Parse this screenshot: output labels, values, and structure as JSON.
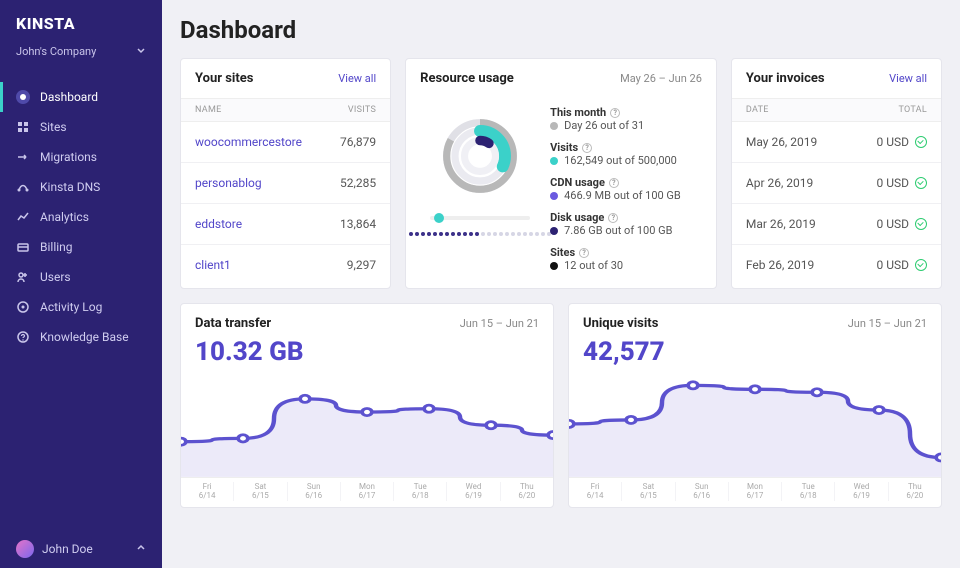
{
  "brand": "KINSTA",
  "company": "John's Company",
  "page_title": "Dashboard",
  "nav": [
    {
      "label": "Dashboard",
      "icon": "home"
    },
    {
      "label": "Sites",
      "icon": "sites"
    },
    {
      "label": "Migrations",
      "icon": "migrate"
    },
    {
      "label": "Kinsta DNS",
      "icon": "dns"
    },
    {
      "label": "Analytics",
      "icon": "analytics"
    },
    {
      "label": "Billing",
      "icon": "billing"
    },
    {
      "label": "Users",
      "icon": "users"
    },
    {
      "label": "Activity Log",
      "icon": "log"
    },
    {
      "label": "Knowledge Base",
      "icon": "kb"
    }
  ],
  "user": {
    "name": "John Doe"
  },
  "sites_card": {
    "title": "Your sites",
    "view_all": "View all",
    "head_name": "NAME",
    "head_visits": "VISITS",
    "rows": [
      {
        "name": "woocommercestore",
        "visits": "76,879"
      },
      {
        "name": "personablog",
        "visits": "52,285"
      },
      {
        "name": "eddstore",
        "visits": "13,864"
      },
      {
        "name": "client1",
        "visits": "9,297"
      }
    ]
  },
  "resource_card": {
    "title": "Resource usage",
    "range": "May 26 – Jun 26",
    "stats": [
      {
        "label": "This month",
        "value": "Day 26 out of 31",
        "color": "#b8b8b8"
      },
      {
        "label": "Visits",
        "value": "162,549 out of 500,000",
        "color": "#3bd1c9"
      },
      {
        "label": "CDN usage",
        "value": "466.9 MB out of 100 GB",
        "color": "#6a5ae0"
      },
      {
        "label": "Disk usage",
        "value": "7.86 GB out of 100 GB",
        "color": "#2c2272"
      },
      {
        "label": "Sites",
        "value": "12 out of 30",
        "color": "#111"
      }
    ]
  },
  "invoices_card": {
    "title": "Your invoices",
    "view_all": "View all",
    "head_date": "DATE",
    "head_total": "TOTAL",
    "rows": [
      {
        "date": "May 26, 2019",
        "amount": "0 USD"
      },
      {
        "date": "Apr 26, 2019",
        "amount": "0 USD"
      },
      {
        "date": "Mar 26, 2019",
        "amount": "0 USD"
      },
      {
        "date": "Feb 26, 2019",
        "amount": "0 USD"
      }
    ]
  },
  "data_transfer_card": {
    "title": "Data transfer",
    "range": "Jun 15 – Jun 21",
    "big_value": "10.32 GB",
    "axis": [
      {
        "dow": "Fri",
        "date": "6/14"
      },
      {
        "dow": "Sat",
        "date": "6/15"
      },
      {
        "dow": "Sun",
        "date": "6/16"
      },
      {
        "dow": "Mon",
        "date": "6/17"
      },
      {
        "dow": "Tue",
        "date": "6/18"
      },
      {
        "dow": "Wed",
        "date": "6/19"
      },
      {
        "dow": "Thu",
        "date": "6/20"
      }
    ]
  },
  "unique_visits_card": {
    "title": "Unique visits",
    "range": "Jun 15 – Jun 21",
    "big_value": "42,577",
    "axis": [
      {
        "dow": "Fri",
        "date": "6/14"
      },
      {
        "dow": "Sat",
        "date": "6/15"
      },
      {
        "dow": "Sun",
        "date": "6/16"
      },
      {
        "dow": "Mon",
        "date": "6/17"
      },
      {
        "dow": "Tue",
        "date": "6/18"
      },
      {
        "dow": "Wed",
        "date": "6/19"
      },
      {
        "dow": "Thu",
        "date": "6/20"
      }
    ]
  },
  "chart_data": [
    {
      "type": "line",
      "title": "Data transfer",
      "xlabel": "",
      "ylabel": "",
      "categories": [
        "6/14",
        "6/15",
        "6/16",
        "6/17",
        "6/18",
        "6/19",
        "6/20"
      ],
      "values": [
        0.9,
        1.0,
        2.2,
        1.8,
        1.9,
        1.4,
        1.1
      ],
      "ylim": [
        0,
        3
      ],
      "unit": "GB"
    },
    {
      "type": "line",
      "title": "Unique visits",
      "xlabel": "",
      "ylabel": "",
      "categories": [
        "6/14",
        "6/15",
        "6/16",
        "6/17",
        "6/18",
        "6/19",
        "6/20"
      ],
      "values": [
        4800,
        5200,
        8700,
        8300,
        8000,
        6200,
        1400
      ],
      "ylim": [
        0,
        10000
      ]
    },
    {
      "type": "donut",
      "title": "Resource usage",
      "series": [
        {
          "name": "Month progress",
          "value": 26,
          "max": 31,
          "color": "#b8b8b8"
        },
        {
          "name": "Visits",
          "value": 162549,
          "max": 500000,
          "color": "#3bd1c9"
        },
        {
          "name": "CDN usage MB",
          "value": 466.9,
          "max": 102400,
          "color": "#6a5ae0"
        },
        {
          "name": "Disk usage GB",
          "value": 7.86,
          "max": 100,
          "color": "#2c2272"
        },
        {
          "name": "Sites",
          "value": 12,
          "max": 30,
          "color": "#111"
        }
      ]
    }
  ]
}
